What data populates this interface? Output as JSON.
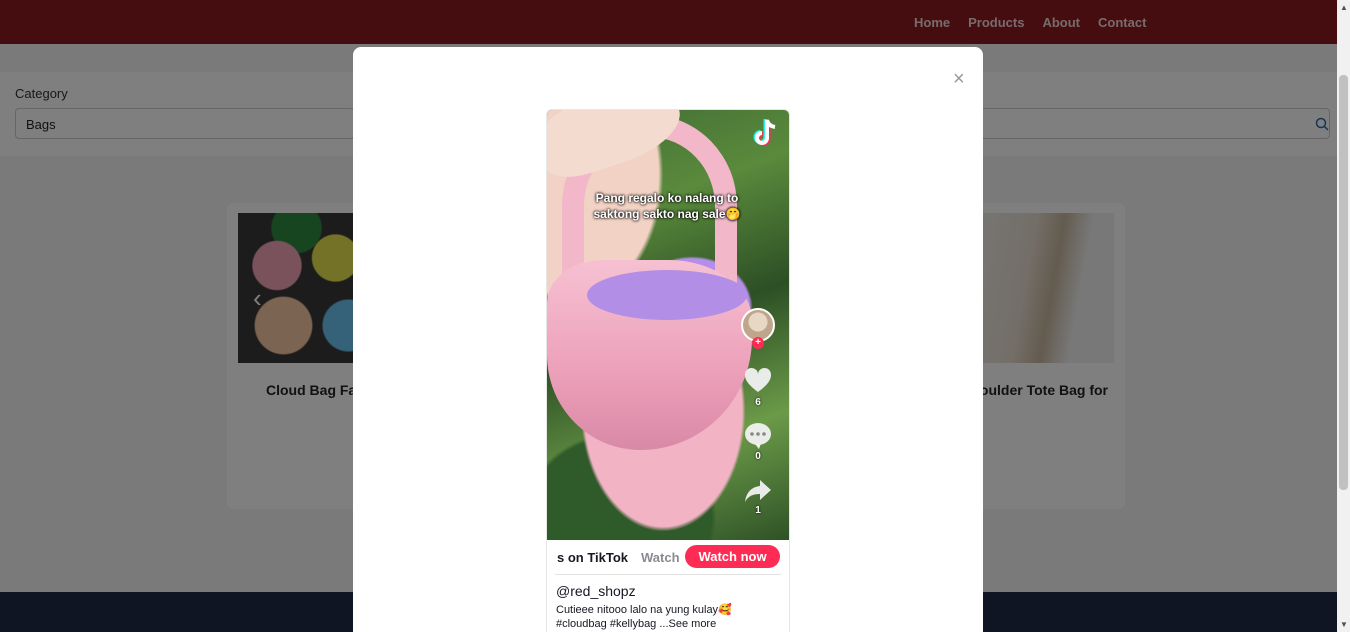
{
  "nav": {
    "items": [
      "Home",
      "Products",
      "About",
      "Contact"
    ]
  },
  "filter": {
    "label": "Category",
    "value": "Bags"
  },
  "products": [
    {
      "title": "Cloud Bag Fa"
    },
    {
      "title": "oulder Tote Bag for"
    }
  ],
  "modal": {
    "close_label": "×"
  },
  "tiktok": {
    "caption_line1": "Pang regalo ko nalang to",
    "caption_line2": "saktong sakto nag sale🤭",
    "likes": "6",
    "comments": "0",
    "shares": "1",
    "bar_text": "s on TikTok",
    "bar_text_faded": "Watch",
    "watch_now": "Watch now",
    "username": "@red_shopz",
    "description_line1": "Cutieee nitooo lalo na yung kulay🥰",
    "description_line2": "#cloudbag #kellybag ...See more",
    "brand_color": "#fe2c55"
  },
  "colors": {
    "navbar": "#8b1a1f",
    "overlay": "rgba(0,0,0,0.5)"
  }
}
